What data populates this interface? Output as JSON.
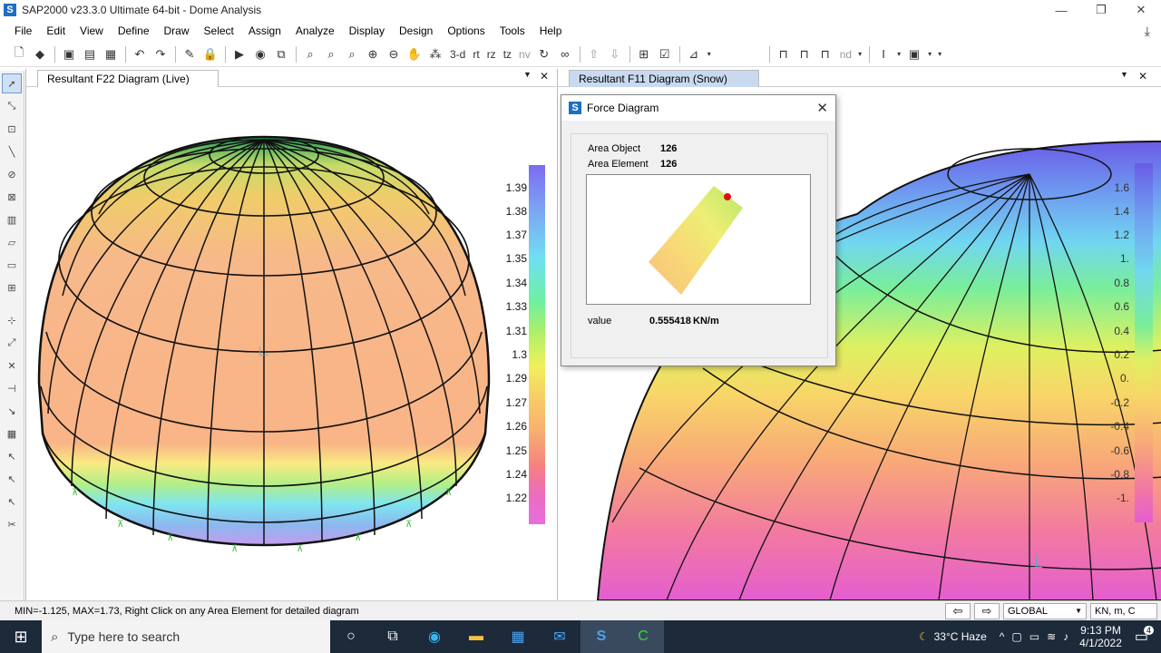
{
  "window": {
    "title": "SAP2000 v23.3.0 Ultimate 64-bit - Dome Analysis",
    "app_icon": "S"
  },
  "window_controls": {
    "minimize": "—",
    "maximize": "❐",
    "close": "✕"
  },
  "menu": [
    "File",
    "Edit",
    "View",
    "Define",
    "Draw",
    "Select",
    "Assign",
    "Analyze",
    "Display",
    "Design",
    "Options",
    "Tools",
    "Help"
  ],
  "toolbar": {
    "text_buttons": [
      "3-d",
      "rt",
      "rz",
      "tz",
      "nv"
    ],
    "nd_label": "nd"
  },
  "left_pane": {
    "tab": "Resultant F22 Diagram (Live)",
    "legend": [
      "1.39",
      "1.38",
      "1.37",
      "1.35",
      "1.34",
      "1.33",
      "1.31",
      "1.3",
      "1.29",
      "1.27",
      "1.26",
      "1.25",
      "1.24",
      "1.22"
    ]
  },
  "right_pane": {
    "tab": "Resultant F11 Diagram (Snow)",
    "legend": [
      "1.6",
      "1.4",
      "1.2",
      "1.",
      "0.8",
      "0.6",
      "0.4",
      "0.2",
      "0.",
      "-0.2",
      "-0.4",
      "-0.6",
      "-0.8",
      "-1."
    ]
  },
  "dialog": {
    "title": "Force Diagram",
    "icon": "S",
    "area_object_label": "Area Object",
    "area_object_value": "126",
    "area_element_label": "Area Element",
    "area_element_value": "126",
    "value_label": "value",
    "value": "0.555418",
    "unit": "KN/m"
  },
  "status": {
    "message": "MIN=-1.125, MAX=1.73, Right Click on any Area Element for detailed diagram",
    "coord_system": "GLOBAL",
    "units": "KN, m, C"
  },
  "taskbar": {
    "search_placeholder": "Type here to search",
    "weather": "33°C  Haze",
    "time": "9:13 PM",
    "date": "4/1/2022",
    "notif_count": "4"
  }
}
